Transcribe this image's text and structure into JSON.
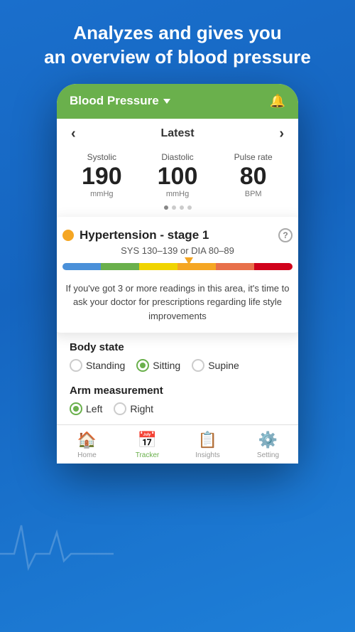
{
  "header": {
    "line1": "Analyzes and gives you",
    "line2": "an overview of blood pressure"
  },
  "app": {
    "title": "Blood Pressure",
    "nav_label": "Latest",
    "metrics": {
      "systolic": {
        "label": "Systolic",
        "value": "190",
        "unit": "mmHg"
      },
      "diastolic": {
        "label": "Diastolic",
        "value": "100",
        "unit": "mmHg"
      },
      "pulse": {
        "label": "Pulse rate",
        "value": "80",
        "unit": "BPM"
      }
    }
  },
  "hypertension": {
    "title": "Hypertension - stage 1",
    "subtitle": "SYS 130–139 or DIA 80–89",
    "description": "If you've got 3 or more readings in this area, it's time to ask your doctor for prescriptions regarding life style improvements"
  },
  "body_state": {
    "title": "Body state",
    "options": [
      {
        "label": "Standing",
        "selected": false
      },
      {
        "label": "Sitting",
        "selected": true
      },
      {
        "label": "Supine",
        "selected": false
      }
    ]
  },
  "arm_measurement": {
    "title": "Arm measurement",
    "options": [
      {
        "label": "Left",
        "selected": true
      },
      {
        "label": "Right",
        "selected": false
      }
    ]
  },
  "bottom_nav": {
    "items": [
      {
        "label": "Home",
        "active": false,
        "icon": "🏠"
      },
      {
        "label": "Tracker",
        "active": true,
        "icon": "📅"
      },
      {
        "label": "Insights",
        "active": false,
        "icon": "📋"
      },
      {
        "label": "Setting",
        "active": false,
        "icon": "⚙️"
      }
    ]
  },
  "colors": {
    "green": "#6ab04c",
    "blue_bg": "#1565C0",
    "orange": "#f5a623"
  }
}
